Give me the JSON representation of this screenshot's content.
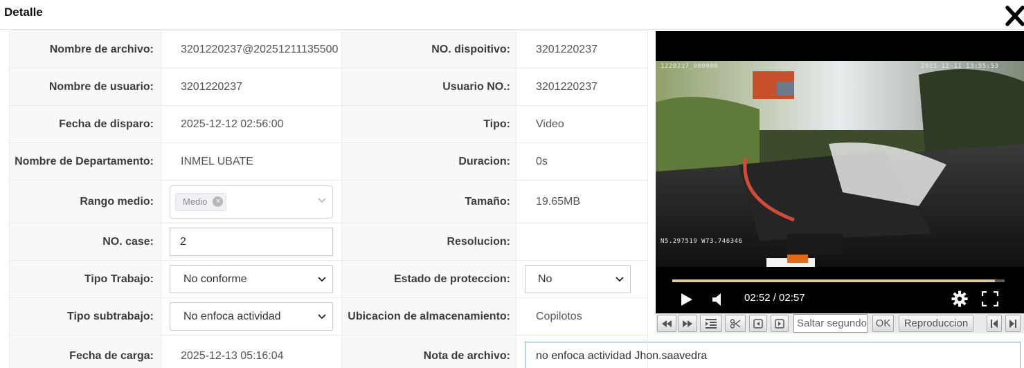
{
  "dialog": {
    "title": "Detalle",
    "close_icon": "close-icon"
  },
  "fields": {
    "nombre_archivo": {
      "label": "Nombre de archivo:",
      "value": "3201220237@20251211135500"
    },
    "no_dispositivo": {
      "label": "NO. dispoitivo:",
      "value": "3201220237"
    },
    "nombre_usuario": {
      "label": "Nombre de usuario:",
      "value": "3201220237"
    },
    "usuario_no": {
      "label": "Usuario NO.:",
      "value": "3201220237"
    },
    "fecha_disparo": {
      "label": "Fecha de disparo:",
      "value": "2025-12-12 02:56:00"
    },
    "tipo": {
      "label": "Tipo:",
      "value": "Video"
    },
    "departamento": {
      "label": "Nombre de Departamento:",
      "value": "INMEL UBATE"
    },
    "duracion": {
      "label": "Duracion:",
      "value": "0s"
    },
    "rango_medio": {
      "label": "Rango medio:",
      "tag": "Medio"
    },
    "tamano": {
      "label": "Tamaño:",
      "value": "19.65MB"
    },
    "no_case": {
      "label": "NO. case:",
      "value": "2"
    },
    "resolucion": {
      "label": "Resolucion:",
      "value": ""
    },
    "tipo_trabajo": {
      "label": "Tipo Trabajo:",
      "value": "No conforme"
    },
    "estado_proteccion": {
      "label": "Estado de proteccion:",
      "value": "No"
    },
    "tipo_subtrabajo": {
      "label": "Tipo subtrabajo:",
      "value": "No enfoca actividad"
    },
    "ubicacion": {
      "label": "Ubicacion de almacenamiento:",
      "value": "Copilotos"
    },
    "fecha_carga": {
      "label": "Fecha de carga:",
      "value": "2025-12-13 05:16:04"
    },
    "nota": {
      "label": "Nota de archivo:",
      "value": "no enfoca actividad Jhon.saavedra"
    }
  },
  "player": {
    "osd_left": "1220237_000000",
    "osd_right": "2025-12-11 13:55:53",
    "osd_gps": "N5.297519 W73.746346",
    "time": "02:52 / 02:57",
    "progress": 0.97
  },
  "toolbar": {
    "jump_placeholder": "Saltar segundos",
    "ok_label": "OK",
    "playback_label": "Reproduccion"
  }
}
